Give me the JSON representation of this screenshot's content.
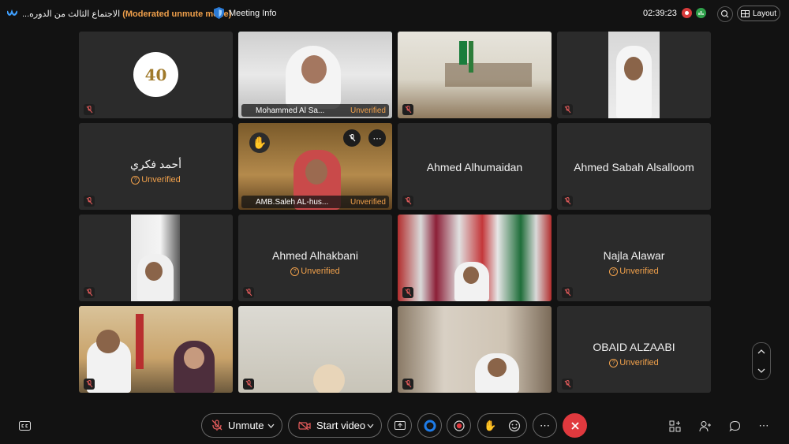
{
  "app": {
    "title": "...الاجتماع الثالث من الدوره",
    "mode": "(Moderated unmute mode)",
    "meeting_info": "Meeting Info",
    "timer": "02:39:23",
    "layout_label": "Layout"
  },
  "tiles": [
    {
      "name": "",
      "unverified": ""
    },
    {
      "name": "Mohammed Al Sa...",
      "unverified": "Unverified"
    },
    {
      "name": "",
      "unverified": ""
    },
    {
      "name": "",
      "unverified": ""
    },
    {
      "name": "أحمد فكري",
      "unverified": "Unverified"
    },
    {
      "name": "AMB.Saleh AL-hus...",
      "unverified": "Unverified"
    },
    {
      "name": "Ahmed Alhumaidan",
      "unverified": ""
    },
    {
      "name": "Ahmed Sabah Alsalloom",
      "unverified": ""
    },
    {
      "name": "",
      "unverified": ""
    },
    {
      "name": "Ahmed Alhakbani",
      "unverified": "Unverified"
    },
    {
      "name": "",
      "unverified": ""
    },
    {
      "name": "Najla Alawar",
      "unverified": "Unverified"
    },
    {
      "name": "",
      "unverified": ""
    },
    {
      "name": "",
      "unverified": ""
    },
    {
      "name": "",
      "unverified": ""
    },
    {
      "name": "OBAID ALZAABI",
      "unverified": "Unverified"
    }
  ],
  "logo_text": "40",
  "controls": {
    "unmute": "Unmute",
    "start_video": "Start video"
  },
  "icons": [
    "webex-logo-icon",
    "shield-icon",
    "recording-icon",
    "stats-icon",
    "zoom-icon",
    "layout-icon",
    "mic-off-icon",
    "raised-hand-icon",
    "more-icon",
    "share-icon",
    "ai-assistant-icon",
    "record-icon",
    "reactions-icon",
    "end-call-icon",
    "apps-icon",
    "participants-icon",
    "chat-icon",
    "captions-icon",
    "chevron-up-icon",
    "chevron-down-icon"
  ],
  "colors": {
    "accent": "#4fb0a0",
    "warning": "#f0a04b",
    "end_call": "#e0393e",
    "record": "#d83b3b",
    "stats": "#2fa04a"
  }
}
